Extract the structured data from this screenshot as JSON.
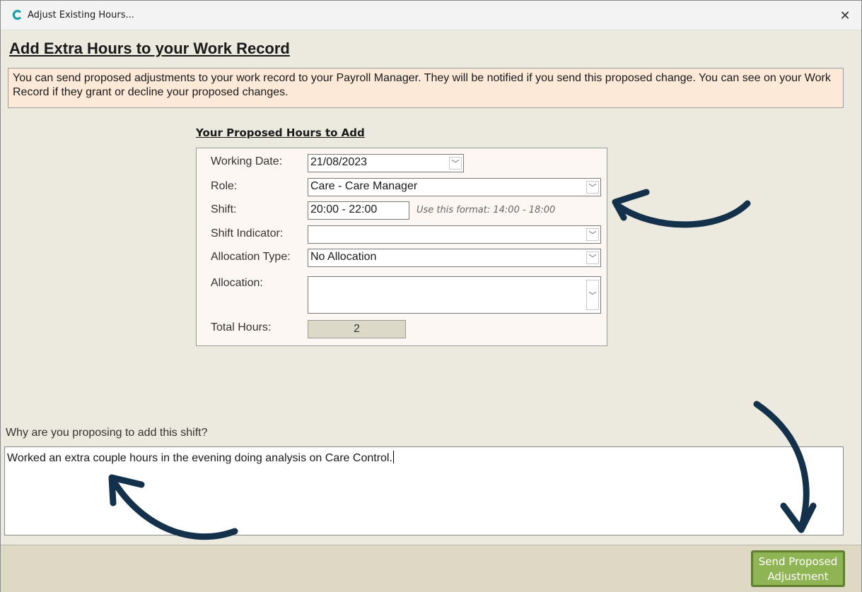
{
  "window": {
    "title": "Adjust Existing Hours...",
    "close_glyph": "✕"
  },
  "heading": "Add Extra Hours to your Work Record",
  "info": "You can send proposed adjustments to your work record to your Payroll Manager.  They will be notified if you send this proposed change.  You can see on your Work Record if they grant or decline your proposed changes.",
  "form": {
    "section_title": "Your Proposed Hours to Add",
    "working_date": {
      "label": "Working Date:",
      "value": "21/08/2023"
    },
    "role": {
      "label": "Role:",
      "value": "Care - Care Manager"
    },
    "shift": {
      "label": "Shift:",
      "value": "20:00 - 22:00",
      "hint": "Use this format: 14:00 - 18:00"
    },
    "shift_indicator": {
      "label": "Shift Indicator:",
      "value": ""
    },
    "allocation_type": {
      "label": "Allocation Type:",
      "value": "No Allocation"
    },
    "allocation": {
      "label": "Allocation:",
      "value": ""
    },
    "total_hours": {
      "label": "Total Hours:",
      "value": "2"
    },
    "dropdown_glyph": "﹀"
  },
  "reason": {
    "label": "Why are you proposing to add this shift?",
    "value": "Worked an extra couple hours in the evening doing analysis on Care Control."
  },
  "footer": {
    "send_button_line1": "Send Proposed",
    "send_button_line2": "Adjustment"
  },
  "colors": {
    "app_icon": "#1aa1a6",
    "arrow": "#13314a",
    "send_button": "#8fb454"
  },
  "icons": {
    "app": "care-control-logo-icon",
    "close": "close-icon",
    "dropdown": "chevron-down-icon",
    "annotation": "curved-arrow-icon"
  }
}
